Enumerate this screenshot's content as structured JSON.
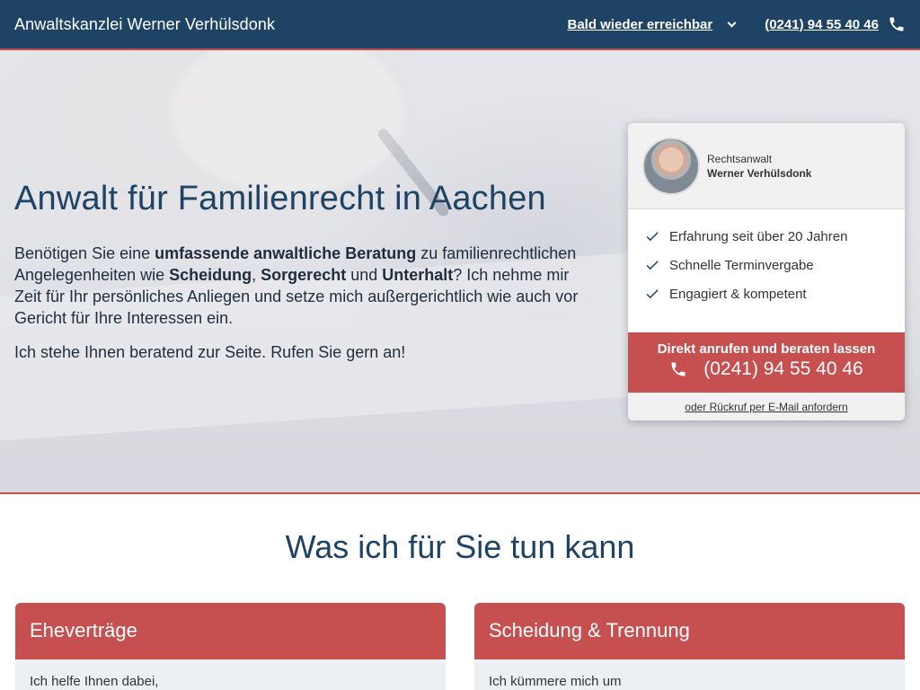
{
  "header": {
    "brand": "Anwaltskanzlei Werner Verhülsdonk",
    "status": "Bald wieder erreichbar",
    "phone": "(0241) 94 55 40 46"
  },
  "hero": {
    "title": "Anwalt für Familienrecht in Aachen",
    "lead": {
      "p1": "Benötigen Sie eine ",
      "b1": "umfassende anwaltliche Beratung",
      "p2": " zu familienrechtlichen Angelegenheiten wie ",
      "b2": "Scheidung",
      "p3": ", ",
      "b3": "Sorgerecht",
      "p4": " und ",
      "b4": "Unterhalt",
      "p5": "? Ich nehme mir Zeit für Ihr persönliches Anliegen und setze mich außergerichtlich wie auch vor Gericht für Ihre Interessen ein."
    },
    "cta": "Ich stehe Ihnen beratend zur Seite. Rufen Sie gern an!"
  },
  "card": {
    "role": "Rechtsanwalt",
    "name": "Werner Verhülsdonk",
    "checks": [
      "Erfahrung seit über 20 Jahren",
      "Schnelle Terminvergabe",
      "Engagiert & kompetent"
    ],
    "call_label": "Direkt anrufen und beraten lassen",
    "call_phone": "(0241) 94 55 40 46",
    "callback_link": "oder Rückruf per E-Mail anfordern"
  },
  "services": {
    "title": "Was ich für Sie tun kann",
    "items": [
      {
        "title": "Eheverträge",
        "text": "Ich helfe Ihnen dabei,"
      },
      {
        "title": "Scheidung & Trennung",
        "text": "Ich kümmere mich um"
      }
    ]
  },
  "colors": {
    "navy": "#1f4365",
    "accent_red": "#c64f4f"
  }
}
